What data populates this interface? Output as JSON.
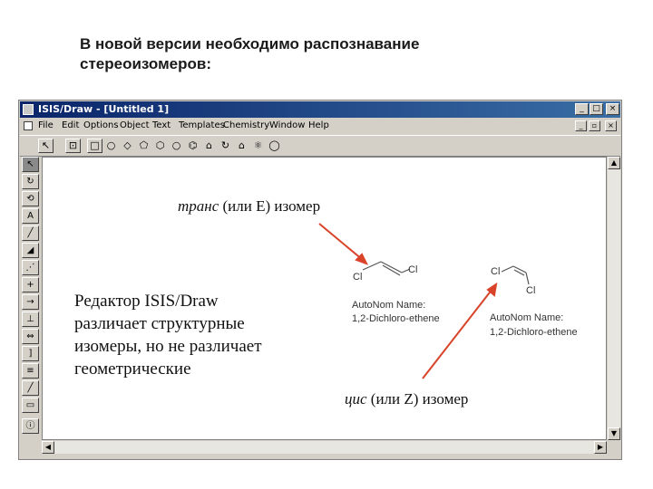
{
  "slide": {
    "heading_line1": "В новой версии необходимо распознавание",
    "heading_line2": "стереоизомеров:"
  },
  "window": {
    "title": "ISIS/Draw - [Untitled 1]",
    "menu": [
      "File",
      "Edit",
      "Options",
      "Object",
      "Text",
      "Templates",
      "Chemistry",
      "Window",
      "Help"
    ]
  },
  "annotations": {
    "trans_italic": "транс",
    "trans_rest": "(или E) изомер",
    "cis_italic": "цис",
    "cis_rest": "(или Z) изомер",
    "editor_line1": "Редактор ISIS/Draw",
    "editor_line2": "различает структурные",
    "editor_line3": "изомеры, но не различает",
    "editor_line4": "геометрические"
  },
  "molecules": {
    "trans": {
      "cl_left": "Cl",
      "cl_right": "Cl",
      "autonom_label": "AutoNom Name:",
      "autonom_value": "1,2-Dichloro-ethene"
    },
    "cis": {
      "cl_left": "Cl",
      "cl_right": "Cl",
      "autonom_label": "AutoNom Name:",
      "autonom_value": "1,2-Dichloro-ethene"
    }
  },
  "colors": {
    "arrow": "#d9432a",
    "titlebar_start": "#0a246a",
    "titlebar_end": "#3a6ea5",
    "window_face": "#d4d0c8"
  },
  "icons": {
    "toolbar": [
      "select-icon",
      "lasso-icon",
      "rectangle-icon",
      "cyclopropane-icon",
      "cyclobutane-icon",
      "cyclopentane-icon",
      "cyclohexane-icon",
      "cycloheptane-icon",
      "benzene-icon",
      "template-icon",
      "rotate-icon",
      "house-icon",
      "atom-icon",
      "ring-icon"
    ],
    "left_tools": [
      "select-tool-icon",
      "rotate-tool-icon",
      "lasso-tool-icon",
      "atom-tool-icon",
      "bond-tool-icon",
      "eraser-tool-icon",
      "chain-tool-icon",
      "plus-tool-icon",
      "arrow-tool-icon",
      "bracket-tool-icon",
      "double-arrow-tool-icon",
      "brace-tool-icon",
      "text-tool-icon",
      "line-tool-icon",
      "box-tool-icon",
      "info-tool-icon"
    ]
  }
}
